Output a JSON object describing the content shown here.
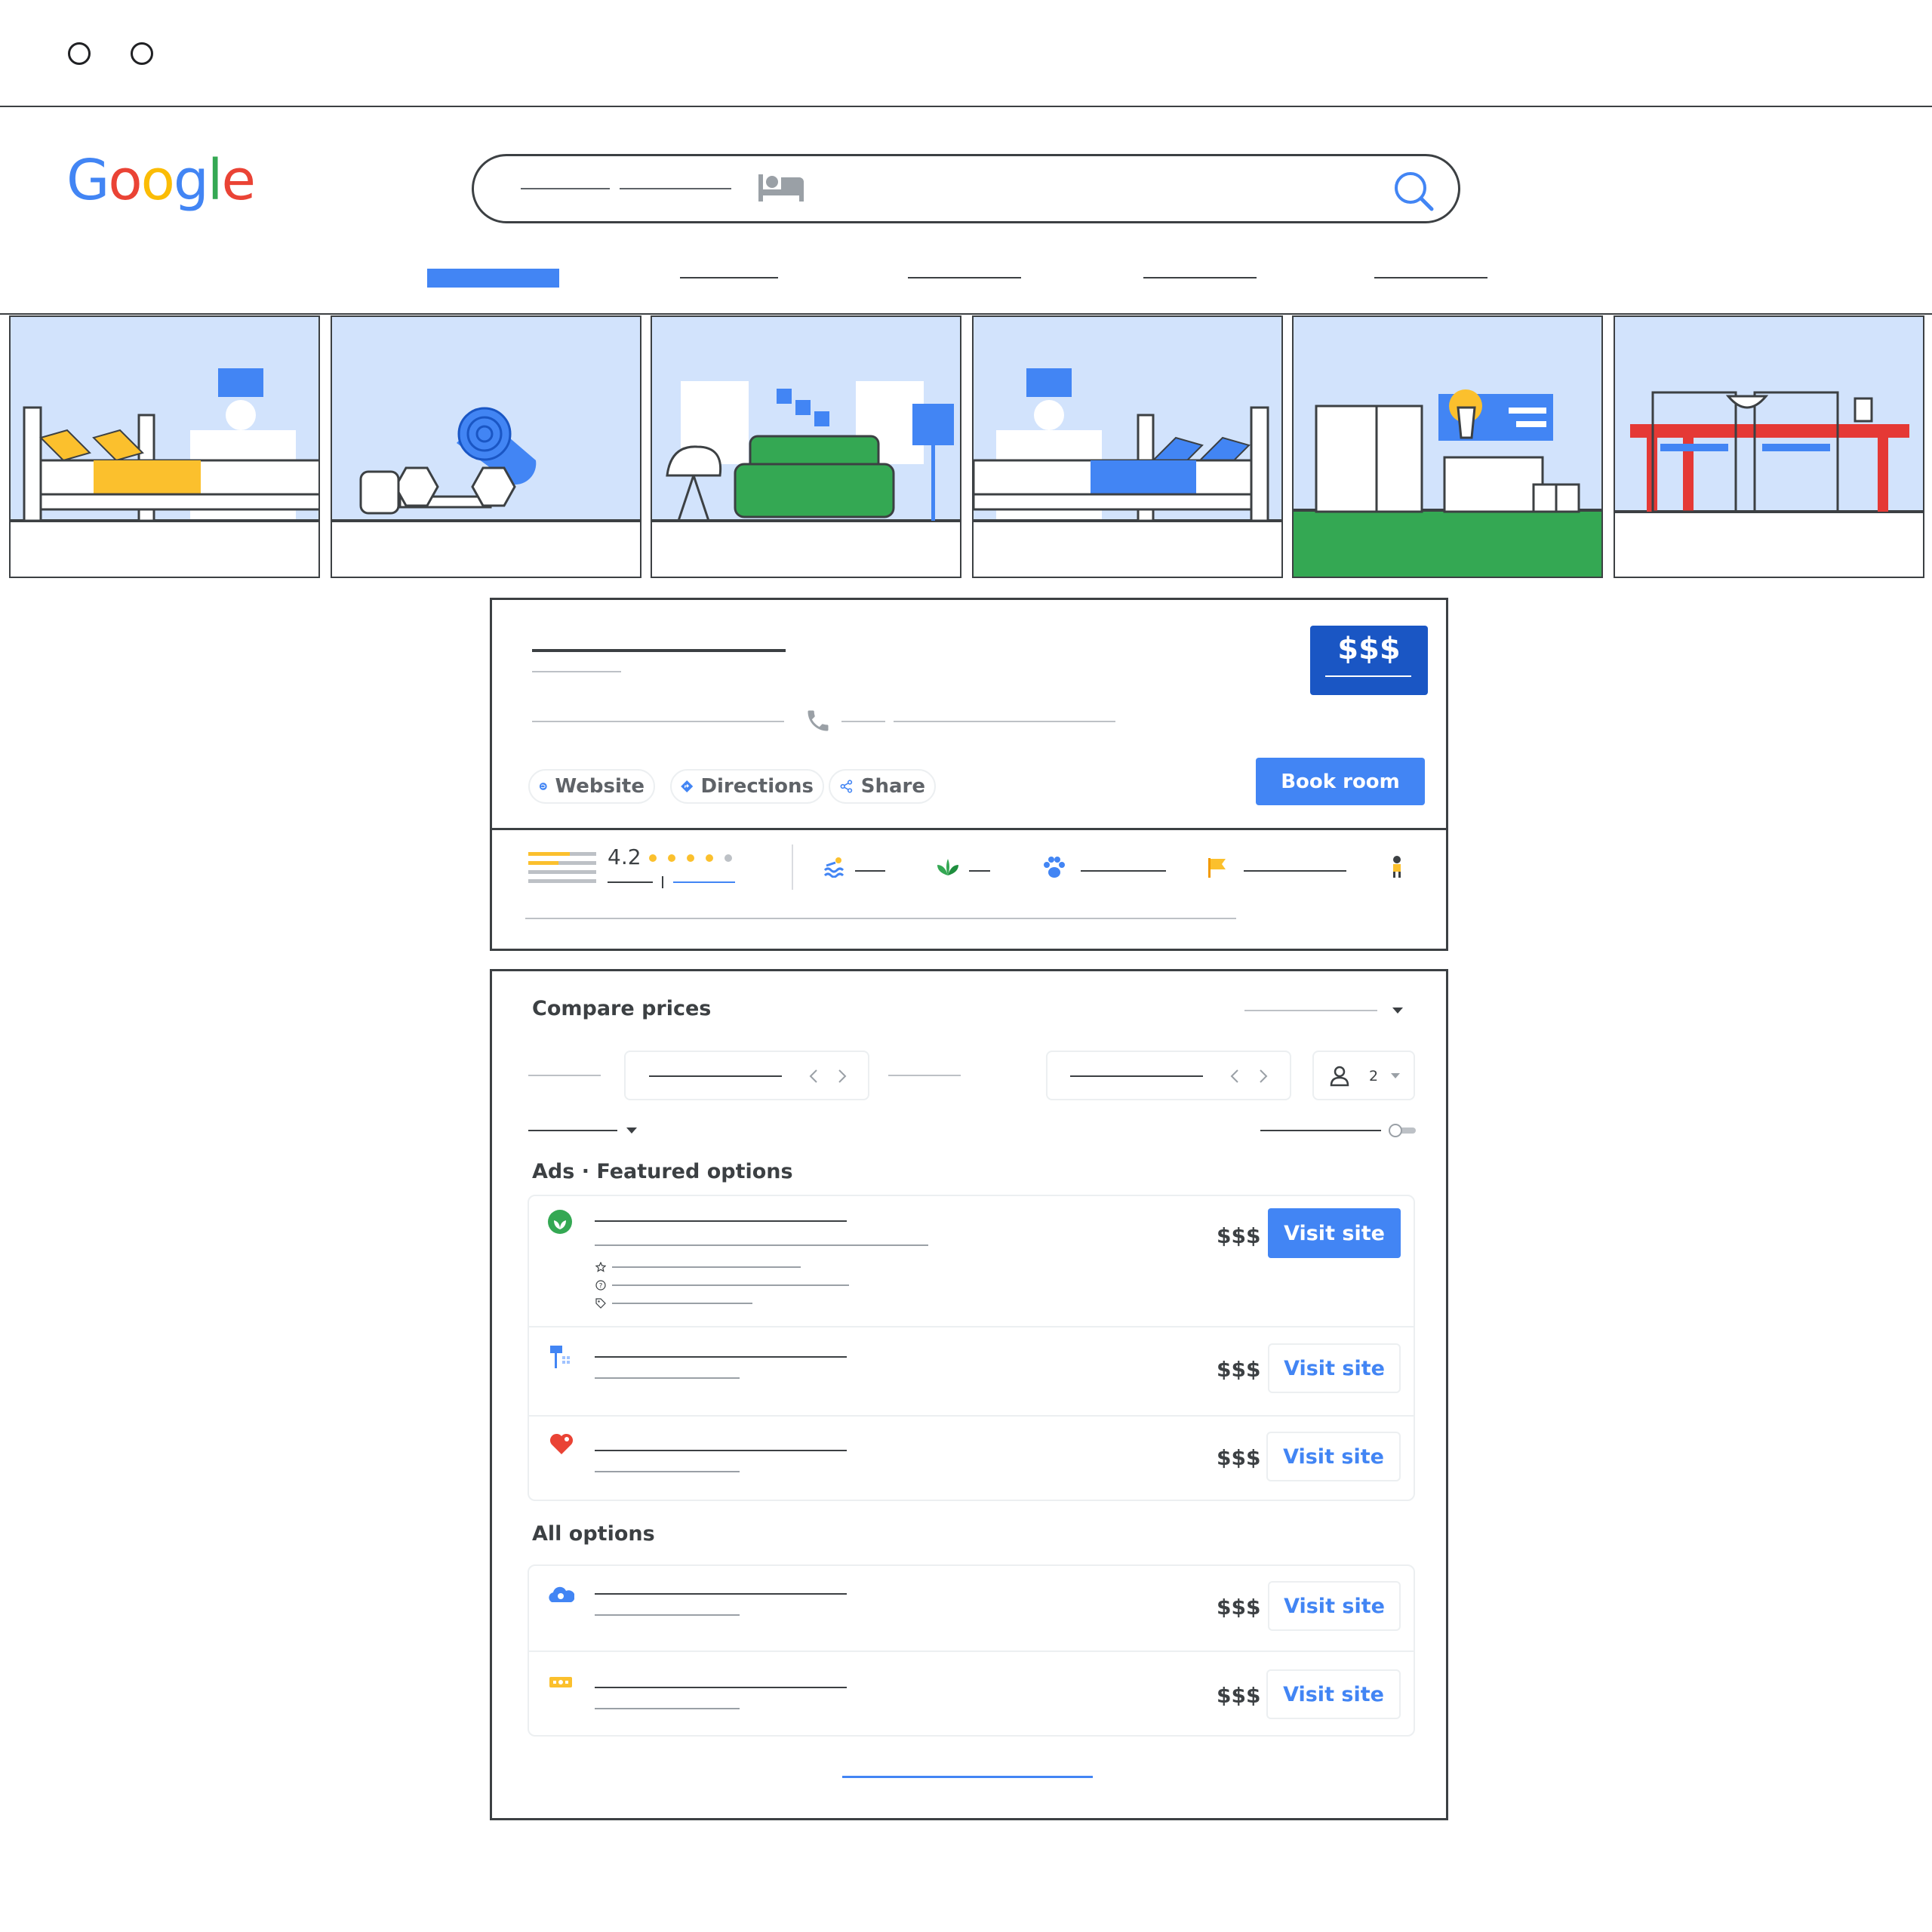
{
  "window": {
    "controls": [
      "window-dot",
      "window-dot"
    ]
  },
  "brand": {
    "logo_text": "Google",
    "colors": [
      "#4285F4",
      "#EA4335",
      "#FBBC05",
      "#4285F4",
      "#34A853",
      "#EA4335"
    ]
  },
  "search": {
    "category_icon": "bed-icon",
    "submit_icon": "search-icon"
  },
  "gallery": {
    "photos": [
      "bedroom-yellow",
      "fitness-equipment",
      "lounge-sofa",
      "bedroom-blue",
      "exterior-buildings",
      "dining-table"
    ]
  },
  "hotel": {
    "price_badge": "$$$",
    "actions": {
      "website": "Website",
      "directions": "Directions",
      "share": "Share",
      "book": "Book room"
    },
    "rating": {
      "value": "4.2",
      "stars": 4,
      "max_stars": 5
    },
    "amenities": [
      "pool-icon",
      "eco-leaf-icon",
      "pet-paw-icon",
      "flag-icon",
      "person-icon"
    ]
  },
  "compare": {
    "title": "Compare prices",
    "guests": "2",
    "featured_title": "Ads · Featured options",
    "all_title": "All options",
    "featured": [
      {
        "logo": "leaf-logo-icon",
        "price": "$$$",
        "cta": "Visit site",
        "primary": true
      },
      {
        "logo": "lamp-logo-icon",
        "price": "$$$",
        "cta": "Visit site",
        "primary": false
      },
      {
        "logo": "heart-logo-icon",
        "price": "$$$",
        "cta": "Visit site",
        "primary": false
      }
    ],
    "all": [
      {
        "logo": "cloud-logo-icon",
        "price": "$$$",
        "cta": "Visit site"
      },
      {
        "logo": "ticket-logo-icon",
        "price": "$$$",
        "cta": "Visit site"
      }
    ]
  },
  "colors": {
    "accent": "#4285f4",
    "badge": "#1a56c4",
    "text": "#3c4043",
    "muted": "#bdc1c6"
  }
}
